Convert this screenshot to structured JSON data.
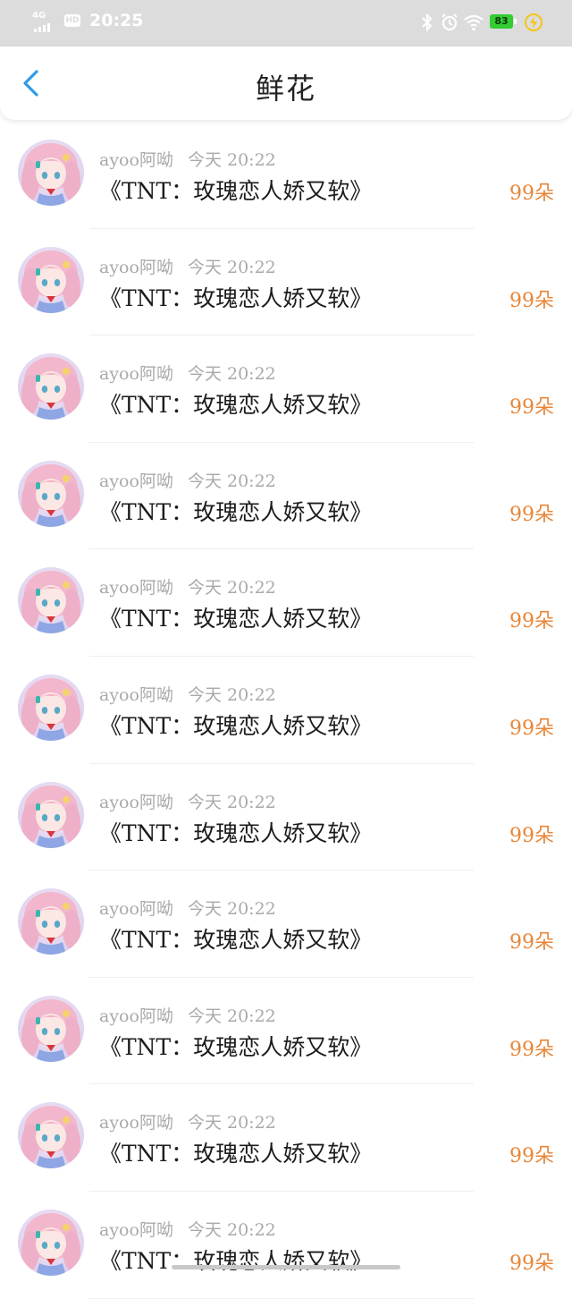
{
  "status_bar": {
    "network": "4G",
    "hd": "HD",
    "time": "20:25",
    "battery": "83",
    "icons": [
      "signal-icon",
      "hd-icon",
      "bluetooth-icon",
      "alarm-icon",
      "wifi-icon",
      "battery-icon",
      "charging-icon"
    ]
  },
  "header": {
    "back_icon": "back-chevron-icon",
    "title": "鲜花"
  },
  "colors": {
    "accent": "#2f9be6",
    "amount": "#e88638",
    "meta": "#a9a9a9"
  },
  "items": [
    {
      "user": "ayoo阿呦",
      "time": "今天 20:22",
      "book": "《TNT：玫瑰恋人娇又软》",
      "amount": "99朵"
    },
    {
      "user": "ayoo阿呦",
      "time": "今天 20:22",
      "book": "《TNT：玫瑰恋人娇又软》",
      "amount": "99朵"
    },
    {
      "user": "ayoo阿呦",
      "time": "今天 20:22",
      "book": "《TNT：玫瑰恋人娇又软》",
      "amount": "99朵"
    },
    {
      "user": "ayoo阿呦",
      "time": "今天 20:22",
      "book": "《TNT：玫瑰恋人娇又软》",
      "amount": "99朵"
    },
    {
      "user": "ayoo阿呦",
      "time": "今天 20:22",
      "book": "《TNT：玫瑰恋人娇又软》",
      "amount": "99朵"
    },
    {
      "user": "ayoo阿呦",
      "time": "今天 20:22",
      "book": "《TNT：玫瑰恋人娇又软》",
      "amount": "99朵"
    },
    {
      "user": "ayoo阿呦",
      "time": "今天 20:22",
      "book": "《TNT：玫瑰恋人娇又软》",
      "amount": "99朵"
    },
    {
      "user": "ayoo阿呦",
      "time": "今天 20:22",
      "book": "《TNT：玫瑰恋人娇又软》",
      "amount": "99朵"
    },
    {
      "user": "ayoo阿呦",
      "time": "今天 20:22",
      "book": "《TNT：玫瑰恋人娇又软》",
      "amount": "99朵"
    },
    {
      "user": "ayoo阿呦",
      "time": "今天 20:22",
      "book": "《TNT：玫瑰恋人娇又软》",
      "amount": "99朵"
    },
    {
      "user": "ayoo阿呦",
      "time": "今天 20:22",
      "book": "《TNT：玫瑰恋人娇又软》",
      "amount": "99朵"
    }
  ]
}
